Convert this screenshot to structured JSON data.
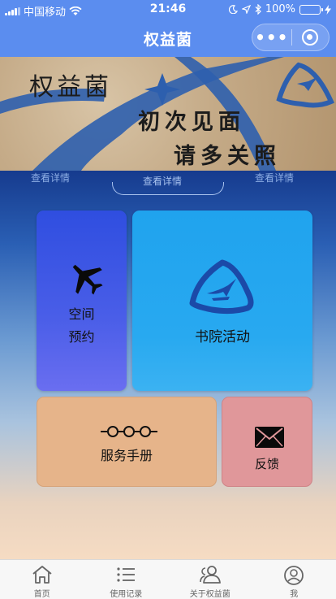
{
  "status_bar": {
    "carrier": "中国移动",
    "time": "21:46",
    "battery": "100%",
    "battery_level": 1.0
  },
  "navbar": {
    "title": "权益菌",
    "more_icon": "more-dots-icon",
    "close_icon": "capsule-close-icon"
  },
  "banner": {
    "line1": "权益菌",
    "line2": "初次见面",
    "line3": "请多关照"
  },
  "details": {
    "items": [
      "查看详情",
      "查看详情",
      "查看详情"
    ],
    "active_index": 1
  },
  "cards": {
    "space": {
      "line1": "空间",
      "line2": "预约",
      "icon": "jet-plane-icon"
    },
    "academy": {
      "label": "书院活动",
      "icon": "academy-logo-icon"
    },
    "manual": {
      "label": "服务手册",
      "icon": "glasses-icon"
    },
    "feedback": {
      "label": "反馈",
      "icon": "envelope-icon"
    }
  },
  "tabbar": {
    "items": [
      {
        "label": "首页",
        "icon": "home-icon"
      },
      {
        "label": "使用记录",
        "icon": "list-icon"
      },
      {
        "label": "关于权益菌",
        "icon": "people-icon"
      },
      {
        "label": "我",
        "icon": "user-icon"
      }
    ]
  },
  "colors": {
    "nav": "#5b8def",
    "space_card": "#3c56e4",
    "academy_card": "#24a6ef",
    "manual_card": "#e6b48a",
    "feedback_card": "#e0979a"
  }
}
